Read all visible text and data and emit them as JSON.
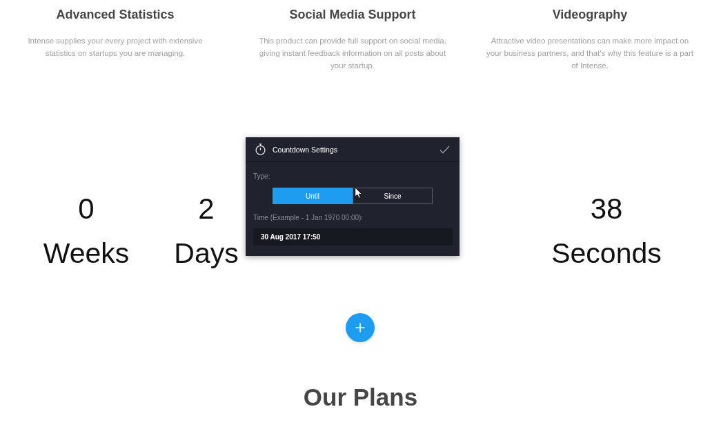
{
  "features": [
    {
      "title": "Advanced Statistics",
      "description": "Intense supplies your every project with extensive\nstatistics on startups you are managing."
    },
    {
      "title": "Social Media Support",
      "description": "This product can provide full support on social media,\ngiving instant feedback information on all posts about\nyour startup."
    },
    {
      "title": "Videography",
      "description": "Attractive video presentations can make more impact on\nyour business partners, and that's why this feature is a part\nof Intense."
    }
  ],
  "countdown": {
    "units": [
      {
        "value": "0",
        "label": "Weeks"
      },
      {
        "value": "2",
        "label": "Days"
      },
      {
        "value": "38",
        "label": "Seconds"
      }
    ]
  },
  "countdown_settings": {
    "title": "Countdown Settings",
    "type_label": "Type:",
    "type_options": [
      {
        "label": "Until",
        "selected": true
      },
      {
        "label": "Since",
        "selected": false
      }
    ],
    "time_label": "Time (Example - 1 Jan 1970 00:00):",
    "time_value": "30 Aug 2017 17:50"
  },
  "section_title": "Our Plans"
}
